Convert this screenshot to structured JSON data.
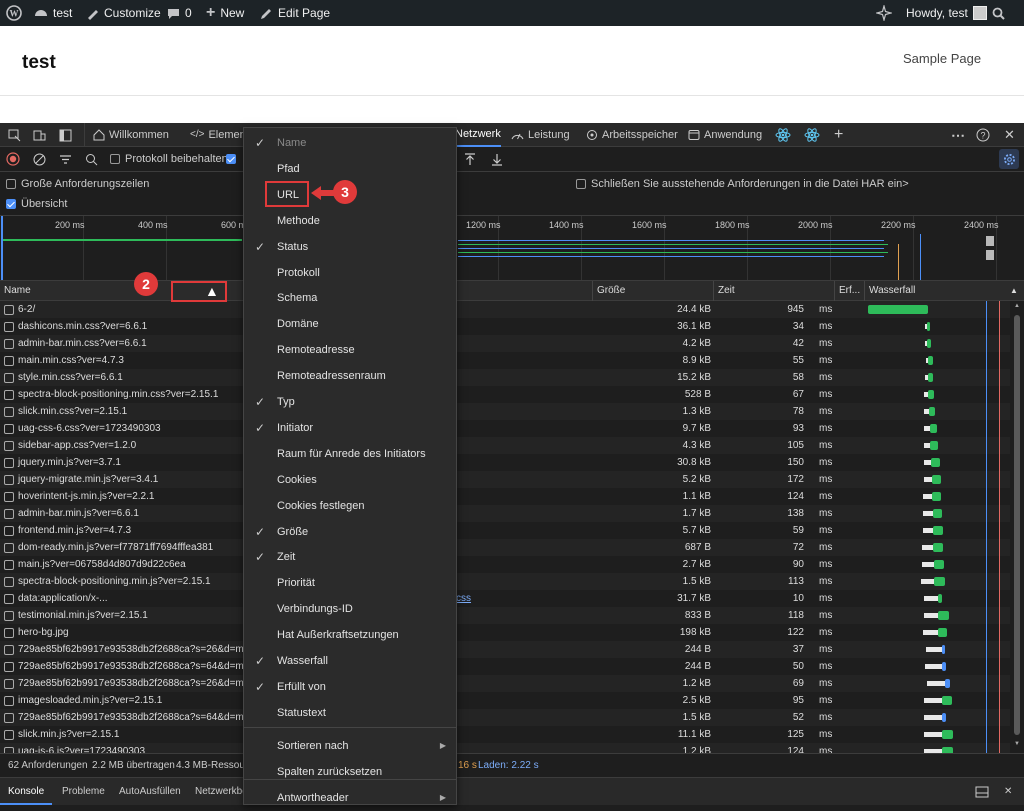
{
  "wp_admin_bar": {
    "site_name": "test",
    "customize": "Customize",
    "comments": "0",
    "new": "New",
    "edit_page": "Edit Page",
    "howdy": "Howdy, test"
  },
  "site": {
    "title": "test",
    "nav_sample_page": "Sample Page"
  },
  "devtools_tabs": {
    "welcome": "Willkommen",
    "elements": "Element",
    "network": "Netzwerk",
    "performance": "Leistung",
    "memory": "Arbeitsspeicher",
    "application": "Anwendung"
  },
  "toolbar": {
    "preserve_log": "Protokoll beibehalten"
  },
  "options": {
    "large_rows": "Große Anforderungszeilen",
    "overview": "Übersicht",
    "har_text": "Schließen Sie ausstehende Anforderungen in die Datei HAR ein>"
  },
  "overview_ticks": [
    "200 ms",
    "400 ms",
    "600 ms",
    "1200 ms",
    "1400 ms",
    "1600 ms",
    "1800 ms",
    "2000 ms",
    "2200 ms",
    "2400 ms"
  ],
  "columns": {
    "name": "Name",
    "size": "Größe",
    "time": "Zeit",
    "fulfilled": "Erf...",
    "waterfall": "Wasserfall"
  },
  "ms_unit": "ms",
  "requests": [
    {
      "name": "6-2/",
      "size": "24.4 kB",
      "time": "945"
    },
    {
      "name": "dashicons.min.css?ver=6.6.1",
      "size": "36.1 kB",
      "time": "34"
    },
    {
      "name": "admin-bar.min.css?ver=6.6.1",
      "size": "4.2 kB",
      "time": "42"
    },
    {
      "name": "main.min.css?ver=4.7.3",
      "size": "8.9 kB",
      "time": "55"
    },
    {
      "name": "style.min.css?ver=6.6.1",
      "size": "15.2 kB",
      "time": "58"
    },
    {
      "name": "spectra-block-positioning.min.css?ver=2.15.1",
      "size": "528 B",
      "time": "67"
    },
    {
      "name": "slick.min.css?ver=2.15.1",
      "size": "1.3 kB",
      "time": "78"
    },
    {
      "name": "uag-css-6.css?ver=1723490303",
      "size": "9.7 kB",
      "time": "93"
    },
    {
      "name": "sidebar-app.css?ver=1.2.0",
      "size": "4.3 kB",
      "time": "105"
    },
    {
      "name": "jquery.min.js?ver=3.7.1",
      "size": "30.8 kB",
      "time": "150"
    },
    {
      "name": "jquery-migrate.min.js?ver=3.4.1",
      "size": "5.2 kB",
      "time": "172"
    },
    {
      "name": "hoverintent-js.min.js?ver=2.2.1",
      "size": "1.1 kB",
      "time": "124"
    },
    {
      "name": "admin-bar.min.js?ver=6.6.1",
      "size": "1.7 kB",
      "time": "138"
    },
    {
      "name": "frontend.min.js?ver=4.7.3",
      "size": "5.7 kB",
      "time": "59"
    },
    {
      "name": "dom-ready.min.js?ver=f77871ff7694fffea381",
      "size": "687 B",
      "time": "72"
    },
    {
      "name": "main.js?ver=06758d4d807d9d22c6ea",
      "size": "2.7 kB",
      "time": "90"
    },
    {
      "name": "spectra-block-positioning.min.js?ver=2.15.1",
      "size": "1.5 kB",
      "time": "113"
    },
    {
      "name": "data:application/x-...",
      "size": "31.7 kB",
      "time": "10"
    },
    {
      "name": "testimonial.min.js?ver=2.15.1",
      "size": "833 B",
      "time": "118"
    },
    {
      "name": "hero-bg.jpg",
      "size": "198 kB",
      "time": "122"
    },
    {
      "name": "729ae85bf62b9917e93538db2f2688ca?s=26&d=mm",
      "size": "244 B",
      "time": "37"
    },
    {
      "name": "729ae85bf62b9917e93538db2f2688ca?s=64&d=mm",
      "size": "244 B",
      "time": "50"
    },
    {
      "name": "729ae85bf62b9917e93538db2f2688ca?s=26&d=mm",
      "size": "1.2 kB",
      "time": "69"
    },
    {
      "name": "imagesloaded.min.js?ver=2.15.1",
      "size": "2.5 kB",
      "time": "95"
    },
    {
      "name": "729ae85bf62b9917e93538db2f2688ca?s=64&d=mm",
      "size": "1.5 kB",
      "time": "52"
    },
    {
      "name": "slick.min.js?ver=2.15.1",
      "size": "11.1 kB",
      "time": "125"
    },
    {
      "name": "uag-js-6.js?ver=1723490303",
      "size": "1.2 kB",
      "time": "124"
    }
  ],
  "css_link_fragment": "css",
  "status_bar": {
    "requests": "62 Anforderungen",
    "transferred": "2.2 MB übertragen",
    "resources": "4.3 MB-Ressou",
    "finish_fragment": "16 s",
    "load": "Laden: 2.22 s"
  },
  "drawer": {
    "console": "Konsole",
    "issues": "Probleme",
    "autofill": "AutoAusfüllen",
    "network_conditions": "Netzwerkbe"
  },
  "context_menu": [
    {
      "label": "Name",
      "checked": true,
      "disabled": true
    },
    {
      "label": "Pfad",
      "checked": false
    },
    {
      "label": "URL",
      "checked": false
    },
    {
      "label": "Methode",
      "checked": false
    },
    {
      "label": "Status",
      "checked": true
    },
    {
      "label": "Protokoll",
      "checked": false
    },
    {
      "label": "Schema",
      "checked": false
    },
    {
      "label": "Domäne",
      "checked": false
    },
    {
      "label": "Remoteadresse",
      "checked": false
    },
    {
      "label": "Remoteadressenraum",
      "checked": false
    },
    {
      "label": "Typ",
      "checked": true
    },
    {
      "label": "Initiator",
      "checked": true
    },
    {
      "label": "Raum für Anrede des Initiators",
      "checked": false
    },
    {
      "label": "Cookies",
      "checked": false
    },
    {
      "label": "Cookies festlegen",
      "checked": false
    },
    {
      "label": "Größe",
      "checked": true
    },
    {
      "label": "Zeit",
      "checked": true
    },
    {
      "label": "Priorität",
      "checked": false
    },
    {
      "label": "Verbindungs-ID",
      "checked": false
    },
    {
      "label": "Hat Außerkraftsetzungen",
      "checked": false
    },
    {
      "label": "Wasserfall",
      "checked": true
    },
    {
      "label": "Erfüllt von",
      "checked": true
    },
    {
      "label": "Statustext",
      "checked": false
    },
    {
      "label": "Sortieren nach",
      "checked": false,
      "submenu": true
    },
    {
      "label": "Spalten zurücksetzen",
      "checked": false
    },
    {
      "label": "Antwortheader",
      "checked": false,
      "submenu": true
    }
  ],
  "annotations": {
    "step2": "2",
    "step3": "3"
  },
  "colors": {
    "accent": "#4c8ff7",
    "annotation": "#e03a3a",
    "waterfall_green": "#2ebb5a"
  }
}
